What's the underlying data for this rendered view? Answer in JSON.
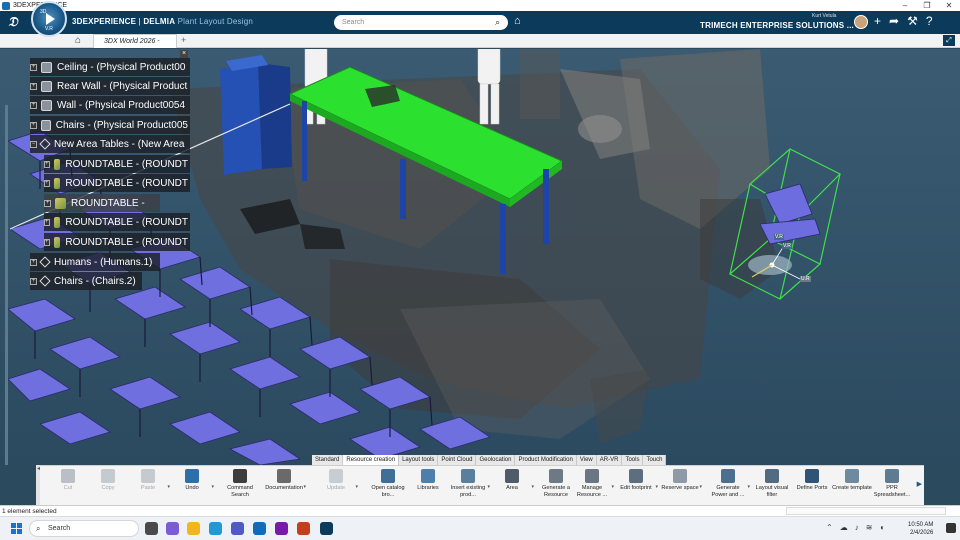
{
  "os_window": {
    "title": "3DEXPERIENCE",
    "controls": [
      "–",
      "❐",
      "✕"
    ]
  },
  "header": {
    "compass_version": "V.R",
    "compass_tl": "3D",
    "brand_strong": "3DEXPERIENCE",
    "brand_sep": " | ",
    "brand_app": "DELMIA",
    "brand_sub": " Plant Layout Design",
    "search_placeholder": "Search",
    "user_name": "Kurt Vetula",
    "company": "TRIMECH ENTERPRISE SOLUTIONS ...",
    "icons": [
      "search-icon",
      "tag-icon",
      "add-icon",
      "share-icon",
      "tools-icon",
      "help-icon"
    ]
  },
  "tabs": {
    "active": "3DX World 2026 -"
  },
  "spec_tree": {
    "items": [
      {
        "label": "Ceiling - (Physical Product00",
        "icon": "product-icon",
        "indent": 0
      },
      {
        "label": "Rear Wall - (Physical Product",
        "icon": "product-icon",
        "indent": 0
      },
      {
        "label": "Wall - (Physical Product0054",
        "icon": "product-icon",
        "indent": 0
      },
      {
        "label": "Chairs - (Physical Product005",
        "icon": "product-icon",
        "indent": 0
      },
      {
        "label": "New Area Tables - (New Area",
        "icon": "tables-icon",
        "indent": 0
      },
      {
        "label": "ROUNDTABLE - (ROUNDT",
        "icon": "roundtable-icon",
        "indent": 1
      },
      {
        "label": "ROUNDTABLE - (ROUNDT",
        "icon": "roundtable-icon",
        "indent": 1
      },
      {
        "label": "ROUNDTABLE -",
        "icon": "roundtable-icon",
        "indent": 1
      },
      {
        "label": "ROUNDTABLE - (ROUNDT",
        "icon": "roundtable-icon",
        "indent": 1
      },
      {
        "label": "ROUNDTABLE - (ROUNDT",
        "icon": "roundtable-icon",
        "indent": 1
      },
      {
        "label": "Humans - (Humans.1)",
        "icon": "tables-icon",
        "indent": 0
      },
      {
        "label": "Chairs - (Chairs.2)",
        "icon": "tables-icon",
        "indent": 0
      }
    ]
  },
  "robot_labels": {
    "a": "V.R",
    "b": "V.R",
    "c": "U.R"
  },
  "action_tabs": [
    "Standard",
    "Resource creation",
    "Layout tools",
    "Point Cloud",
    "Geolocation",
    "Product Modification",
    "View",
    "AR-VR",
    "Tools",
    "Touch"
  ],
  "action_tab_active": "Resource creation",
  "commands": [
    {
      "label": "Cut",
      "enabled": false,
      "color": "#b9bfc5",
      "icon": "scissors-icon"
    },
    {
      "label": "Copy",
      "enabled": false,
      "color": "#c5cacf",
      "icon": "copy-icon"
    },
    {
      "label": "Paste",
      "enabled": false,
      "color": "#c5cacf",
      "icon": "paste-icon"
    },
    {
      "label": "Undo",
      "enabled": true,
      "color": "#2f6fa8",
      "icon": "undo-icon"
    },
    {
      "label": "Command Search",
      "enabled": true,
      "color": "#3d3d3d",
      "icon": "command-search-icon"
    },
    {
      "label": "Documentation",
      "enabled": true,
      "color": "#6a6a6a",
      "icon": "documentation-icon"
    },
    {
      "label": "Update",
      "enabled": false,
      "color": "#c8cdd2",
      "icon": "update-icon"
    },
    {
      "label": "Open catalog bro...",
      "enabled": true,
      "color": "#3f6e96",
      "icon": "catalog-icon"
    },
    {
      "label": "Libraries",
      "enabled": true,
      "color": "#4d7faa",
      "icon": "libraries-icon"
    },
    {
      "label": "Insert existing prod...",
      "enabled": true,
      "color": "#5a7f9c",
      "icon": "insert-product-icon"
    },
    {
      "label": "Area",
      "enabled": true,
      "color": "#4f5b66",
      "icon": "area-icon"
    },
    {
      "label": "Generate a Resource",
      "enabled": true,
      "color": "#6d7a86",
      "icon": "generate-resource-icon"
    },
    {
      "label": "Manage Resource ...",
      "enabled": true,
      "color": "#6a7682",
      "icon": "manage-resource-icon"
    },
    {
      "label": "Edit footprint",
      "enabled": true,
      "color": "#5d6f7e",
      "icon": "footprint-icon"
    },
    {
      "label": "Reserve space",
      "enabled": true,
      "color": "#8e9aa6",
      "icon": "reserve-space-icon"
    },
    {
      "label": "Generate Power and ...",
      "enabled": true,
      "color": "#4a6f8f",
      "icon": "power-icon"
    },
    {
      "label": "Layout visual filter",
      "enabled": true,
      "color": "#536b80",
      "icon": "filter-icon"
    },
    {
      "label": "Define Ports",
      "enabled": true,
      "color": "#2f5476",
      "icon": "ports-icon"
    },
    {
      "label": "Create template",
      "enabled": true,
      "color": "#6f8a9e",
      "icon": "template-icon"
    },
    {
      "label": "PPR Spreadsheet...",
      "enabled": true,
      "color": "#5e7b92",
      "icon": "spreadsheet-icon"
    }
  ],
  "status": {
    "text": "1 element selected"
  },
  "taskbar": {
    "search_label": "Search",
    "apps": [
      {
        "name": "task-view-icon",
        "color": "#4a4a4a"
      },
      {
        "name": "copilot-icon",
        "color": "#7b5cd6"
      },
      {
        "name": "file-explorer-icon",
        "color": "#f2b61c"
      },
      {
        "name": "edge-icon",
        "color": "#1e9ad6"
      },
      {
        "name": "teams-icon",
        "color": "#5059c9"
      },
      {
        "name": "outlook-icon",
        "color": "#0f6cbd"
      },
      {
        "name": "onenote-icon",
        "color": "#7719aa"
      },
      {
        "name": "powerpoint-icon",
        "color": "#c43e1c"
      },
      {
        "name": "3dexperience-icon",
        "color": "#0b3a5a"
      }
    ],
    "time": "10:50 AM",
    "date": "2/4/2026"
  }
}
